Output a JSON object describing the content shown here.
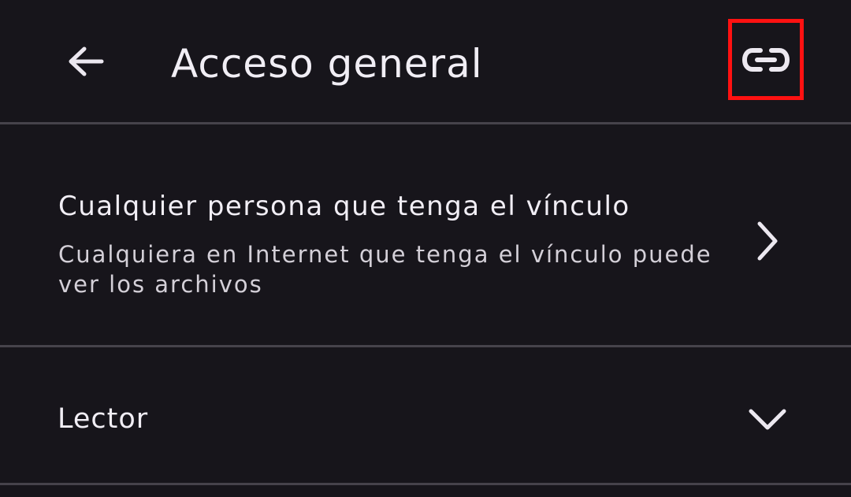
{
  "header": {
    "title": "Acceso general",
    "back_icon": "arrow-left-icon",
    "link_icon": "link-icon",
    "highlight_color": "#ff1111"
  },
  "general_access": {
    "title": "Cualquier persona que tenga el vínculo",
    "description": "Cualquiera en Internet que tenga el vínculo puede ver los archivos",
    "chevron_icon": "chevron-right-icon"
  },
  "role": {
    "label": "Lector",
    "chevron_icon": "chevron-down-icon"
  },
  "colors": {
    "background": "#17151b",
    "divider": "#46434b",
    "text": "#f1eef5",
    "secondary_text": "#d4d0d8"
  }
}
